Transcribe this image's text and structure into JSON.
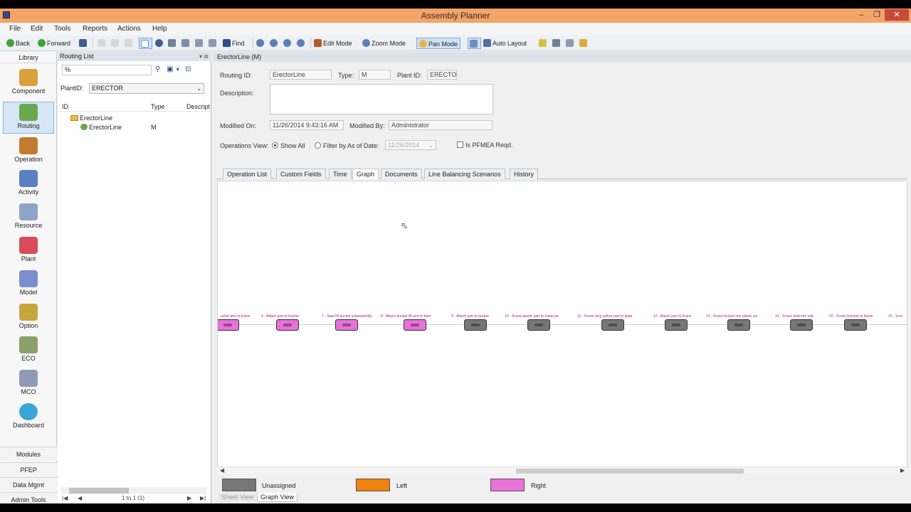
{
  "window": {
    "title": "Assembly Planner"
  },
  "menu": [
    "File",
    "Edit",
    "Tools",
    "Reports",
    "Actions",
    "Help"
  ],
  "toolbar": {
    "back": "Back",
    "forward": "Forward",
    "find": "Find",
    "edit_mode": "Edit Mode",
    "zoom_mode": "Zoom Mode",
    "pan_mode": "Pan Mode",
    "auto_layout": "Auto Layout"
  },
  "nav": {
    "header": "Library",
    "items": [
      {
        "label": "Component",
        "color": "#d9a23a"
      },
      {
        "label": "Routing",
        "color": "#6aa84f"
      },
      {
        "label": "Operation",
        "color": "#c27b2c"
      },
      {
        "label": "Activity",
        "color": "#5b7fc4"
      },
      {
        "label": "Resource",
        "color": "#8fa4c7"
      },
      {
        "label": "Plant",
        "color": "#d94a5a"
      },
      {
        "label": "Model",
        "color": "#7b8ed0"
      },
      {
        "label": "Option",
        "color": "#c7a63f"
      },
      {
        "label": "ECO",
        "color": "#8ba06a"
      },
      {
        "label": "MCO",
        "color": "#8f9bb6"
      },
      {
        "label": "Dashboard",
        "color": "#3aa6d8"
      }
    ],
    "bottom": [
      "Modules",
      "PFEP",
      "Data Mgmt",
      "Admin Tools"
    ]
  },
  "routing_list": {
    "title": "Routing List",
    "search_value": "%",
    "plant_label": "PlantID:",
    "plant_value": "ERECTOR",
    "columns": [
      "ID",
      "Type",
      "Descript"
    ],
    "tree": [
      {
        "id": "ErectorLine",
        "type": ""
      },
      {
        "id": "ErectorLine",
        "type": "M"
      }
    ],
    "pager": "1 to 1 (1)"
  },
  "detail": {
    "header": "ErectorLine (M)",
    "routing_id_label": "Routing ID:",
    "routing_id": "ErectorLine",
    "type_label": "Type:",
    "type": "M",
    "plant_id_label": "Plant ID:",
    "plant_id": "ERECTO",
    "description_label": "Description:",
    "description": "",
    "modified_on_label": "Modified On:",
    "modified_on": "11/26/2014 9:43:16 AM",
    "modified_by_label": "Modified By:",
    "modified_by": "Administrator",
    "ops_view_label": "Operations View:",
    "show_all": "Show All",
    "filter_by": "Filter by As of Date:",
    "filter_date": "11/26/2014",
    "pfmea": "Is PFMEA Reqd."
  },
  "tabs": [
    "Operation List",
    "Custom Fields",
    "Time",
    "Graph",
    "Documents",
    "Line Balancing Scenarios",
    "History"
  ],
  "graph": {
    "nodes": [
      {
        "label": "ucket arm to frame",
        "color": "#e772d8"
      },
      {
        "label": "6 - Attach part to bucket",
        "color": "#e772d8"
      },
      {
        "label": "7 - Start lift bucket subassembly",
        "color": "#e772d8"
      },
      {
        "label": "8 - Attach bucket lift arm to fram",
        "color": "#e772d8"
      },
      {
        "label": "9 - Attach part to bucket",
        "color": "#777777"
      },
      {
        "label": "10 - Screw plastic part to metal pa",
        "color": "#777777"
      },
      {
        "label": "11 - Screw long yellow part to plate",
        "color": "#777777"
      },
      {
        "label": "12 - Attach part to frame",
        "color": "#777777"
      },
      {
        "label": "13 - Screw bucket into plastic pa",
        "color": "#777777"
      },
      {
        "label": "14 - Screw seat into cab",
        "color": "#777777"
      },
      {
        "label": "15 - Screw bracket to frame",
        "color": "#777777"
      },
      {
        "label": "16 - Scre",
        "color": "#777777"
      }
    ]
  },
  "legend": [
    {
      "label": "Unassigned",
      "color": "#777777"
    },
    {
      "label": "Left",
      "color": "#f0820f"
    },
    {
      "label": "Right",
      "color": "#e772d8"
    }
  ],
  "view_tabs": [
    "Sheet View",
    "Graph View"
  ]
}
